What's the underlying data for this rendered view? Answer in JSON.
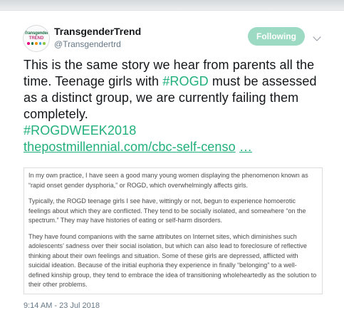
{
  "user": {
    "display_name": "TransgenderTrend",
    "handle": "@Transgendertrd",
    "avatar_text_top": "Transgender",
    "avatar_text_bottom": "TREND"
  },
  "follow_button": {
    "label": "Following"
  },
  "tweet": {
    "text_1": "This is the same story we hear from parents all the time. Teenage girls with ",
    "hashtag_1": "#ROGD",
    "text_2": " must be assessed as a distinct group, we are currently failing them completely.",
    "hashtag_2": "#ROGDWEEK2018",
    "link": "thepostmillennial.com/cbc-self-censo",
    "link_ellipsis": "…"
  },
  "quoted_image": {
    "paragraphs": [
      "In my own practice, I have seen a good many young women displaying the phenomenon known as “rapid onset gender dysphoria,” or ROGD, which overwhelmingly affects girls.",
      "Typically, the ROGD teenage girls I see have, wittingly or not, begun to experience homoerotic feelings about which they are conflicted. They tend to be socially isolated, and somewhere “on the spectrum.” They may have histories of eating or self-harm disorders.",
      "They have found companions with the same attributes on Internet sites, which diminishes such adolescents’ sadness over their social isolation, but which can also lead to foreclosure of reflective thinking about their own feelings and situation. Some of these girls are depressed, afflicted with suicidal ideation. Because of the initial euphoria they experience in finally “belonging” to a well-defined kinship group, they tend to embrace the idea of transitioning wholeheartedly as the solution to their other problems."
    ]
  },
  "timestamp": "9:14 AM - 23 Jul 2018",
  "colors": {
    "accent": "#21b07c",
    "follow_bg": "#9ddac4",
    "text": "#14171a",
    "muted": "#657786"
  },
  "icons": {
    "menu": "chevron-down-icon"
  }
}
